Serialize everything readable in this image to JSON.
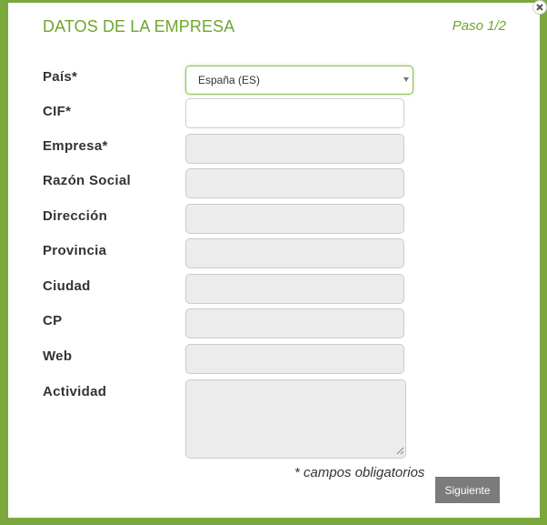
{
  "dialog": {
    "title": "DATOS DE LA EMPRESA",
    "step": "Paso 1/2"
  },
  "form": {
    "pais_label": "País*",
    "pais_value": "España (ES)",
    "cif_label": "CIF*",
    "empresa_label": "Empresa*",
    "razon_social_label": "Razón Social",
    "direccion_label": "Dirección",
    "provincia_label": "Provincia",
    "ciudad_label": "Ciudad",
    "cp_label": "CP",
    "web_label": "Web",
    "actividad_label": "Actividad",
    "required_note": "* campos obligatorios",
    "next_label": "Siguiente"
  },
  "colors": {
    "accent": "#6ea62c",
    "frame": "#7aa83d",
    "button": "#7b7b7b",
    "disabled_field": "#ececec"
  },
  "icons": {
    "close": "close-icon",
    "dropdown": "chevron-down-icon",
    "resize": "resize-grip-icon"
  }
}
